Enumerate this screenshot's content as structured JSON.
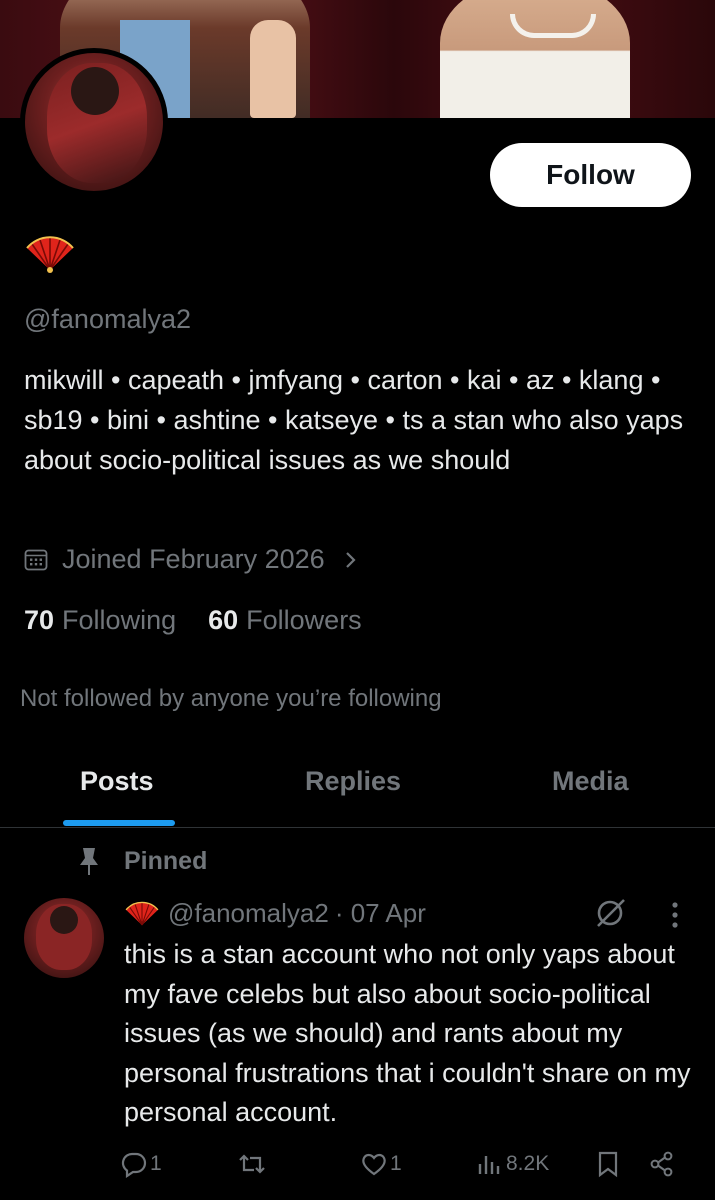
{
  "profile": {
    "follow_label": "Follow",
    "handle": "@fanomalya2",
    "bio": "mikwill • capeath • jmfyang • carton • kai • az • klang • sb19 • bini • ashtine • katseye • ts  a stan who also yaps about socio-political issues as we should",
    "joined": "Joined February 2026",
    "following_count": "70",
    "following_label": "Following",
    "followers_count": "60",
    "followers_label": "Followers",
    "not_followed_text": "Not followed by anyone you’re following"
  },
  "tabs": [
    {
      "label": "Posts",
      "active": true
    },
    {
      "label": "Replies",
      "active": false
    },
    {
      "label": "Media",
      "active": false
    }
  ],
  "post": {
    "pinned_label": "Pinned",
    "handle": "@fanomalya2",
    "date": "· 07 Apr",
    "text": "this is a stan account who not only yaps about my fave celebs but also about socio-political issues (as we should) and rants about my personal frustrations that i couldn't share on my personal account.",
    "replies": "1",
    "likes": "1",
    "views": "8.2K"
  },
  "colors": {
    "accent": "#1d9bf0",
    "muted": "#71767b",
    "text": "#e7e9ea",
    "fan_red": "#e0241b"
  }
}
